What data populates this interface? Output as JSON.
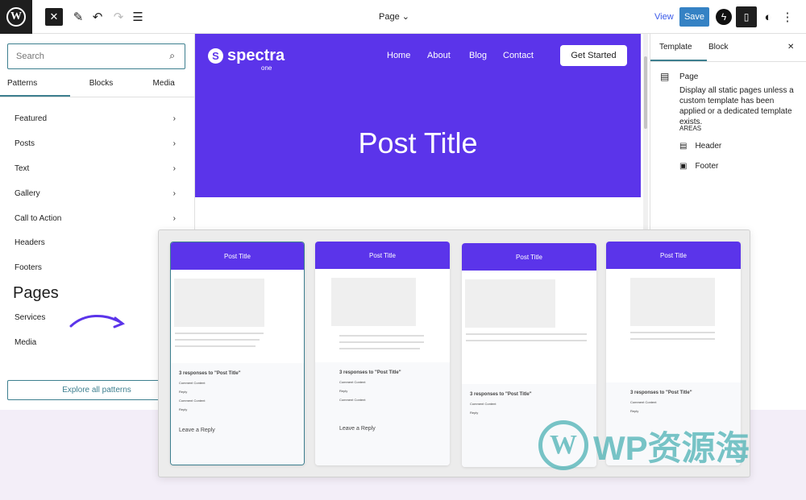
{
  "toolbar": {
    "document_title": "Page",
    "view": "View",
    "save": "Save",
    "close": "✕"
  },
  "left": {
    "search_placeholder": "Search",
    "tabs": [
      "Patterns",
      "Blocks",
      "Media"
    ],
    "categories": [
      "Featured",
      "Posts",
      "Text",
      "Gallery",
      "Call to Action",
      "Headers",
      "Footers"
    ],
    "pages_heading": "Pages",
    "more": [
      "Services",
      "Media"
    ],
    "explore": "Explore all patterns"
  },
  "canvas": {
    "logo": "spectra",
    "logo_sub": "one",
    "nav": [
      "Home",
      "About",
      "Blog",
      "Contact"
    ],
    "cta": "Get Started",
    "title": "Post Title"
  },
  "right": {
    "tabs": [
      "Template",
      "Block"
    ],
    "template_name": "Page",
    "description": "Display all static pages unless a custom template has been applied or a dedicated template exists.",
    "areas_label": "AREAS",
    "areas": [
      "Header",
      "Footer"
    ]
  },
  "previews": {
    "title": "Post Title",
    "responses": "3 responses to \"Post Title\"",
    "comment_content": "Comment Content",
    "reply": "Reply",
    "leave_reply": "Leave a Reply"
  },
  "watermark": "WP资源海",
  "colors": {
    "brand": "#5b34ea",
    "accent": "#3d7f8f",
    "save": "#3582c4"
  }
}
